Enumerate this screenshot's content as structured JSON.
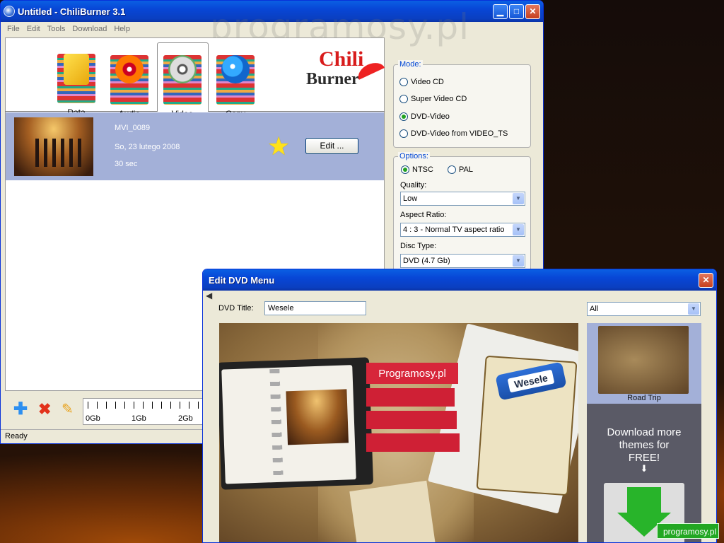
{
  "main": {
    "title": "Untitled - ChiliBurner 3.1",
    "menu": [
      "File",
      "Edit",
      "Tools",
      "Download",
      "Help"
    ],
    "watermark": "programosy.pl",
    "tabs": [
      {
        "label": "Data"
      },
      {
        "label": "Audio"
      },
      {
        "label": "Video"
      },
      {
        "label": "Copy"
      }
    ],
    "active_tab": "Video",
    "logo": "ChiliBurner",
    "logo_chili": "Chili",
    "logo_burner": "Burner",
    "clip": {
      "name": "MVI_0089",
      "date": "So, 23 lutego 2008",
      "duration": "30 sec",
      "edit_label": "Edit ..."
    },
    "mode": {
      "title": "Mode:",
      "options": [
        "Video CD",
        "Super Video CD",
        "DVD-Video",
        "DVD-Video from VIDEO_TS"
      ],
      "selected": "DVD-Video"
    },
    "options": {
      "title": "Options:",
      "tv": [
        "NTSC",
        "PAL"
      ],
      "tv_selected": "NTSC",
      "quality_label": "Quality:",
      "quality": "Low",
      "aspect_label": "Aspect Ratio:",
      "aspect": "4 : 3 - Normal TV aspect ratio",
      "disc_label": "Disc Type:",
      "disc": "DVD (4.7 Gb)"
    },
    "ruler": [
      "0Gb",
      "1Gb",
      "2Gb"
    ],
    "status": "Ready"
  },
  "dialog": {
    "title": "Edit DVD Menu",
    "dvd_title_label": "DVD Title:",
    "dvd_title": "Wesele",
    "filter": "All",
    "preview": {
      "banner": "Programosy.pl",
      "tag": "Wesele"
    },
    "themes": [
      {
        "label": "Road Trip"
      }
    ],
    "download_text": "Download more themes for FREE!",
    "download_arrow": "⬇"
  },
  "badge": "programosy.pl",
  "colors": {
    "selection": "#a3b0d8",
    "title_blue": "#0a4fd9",
    "close_red": "#d04b2a",
    "accent_green": "#1db51d"
  }
}
